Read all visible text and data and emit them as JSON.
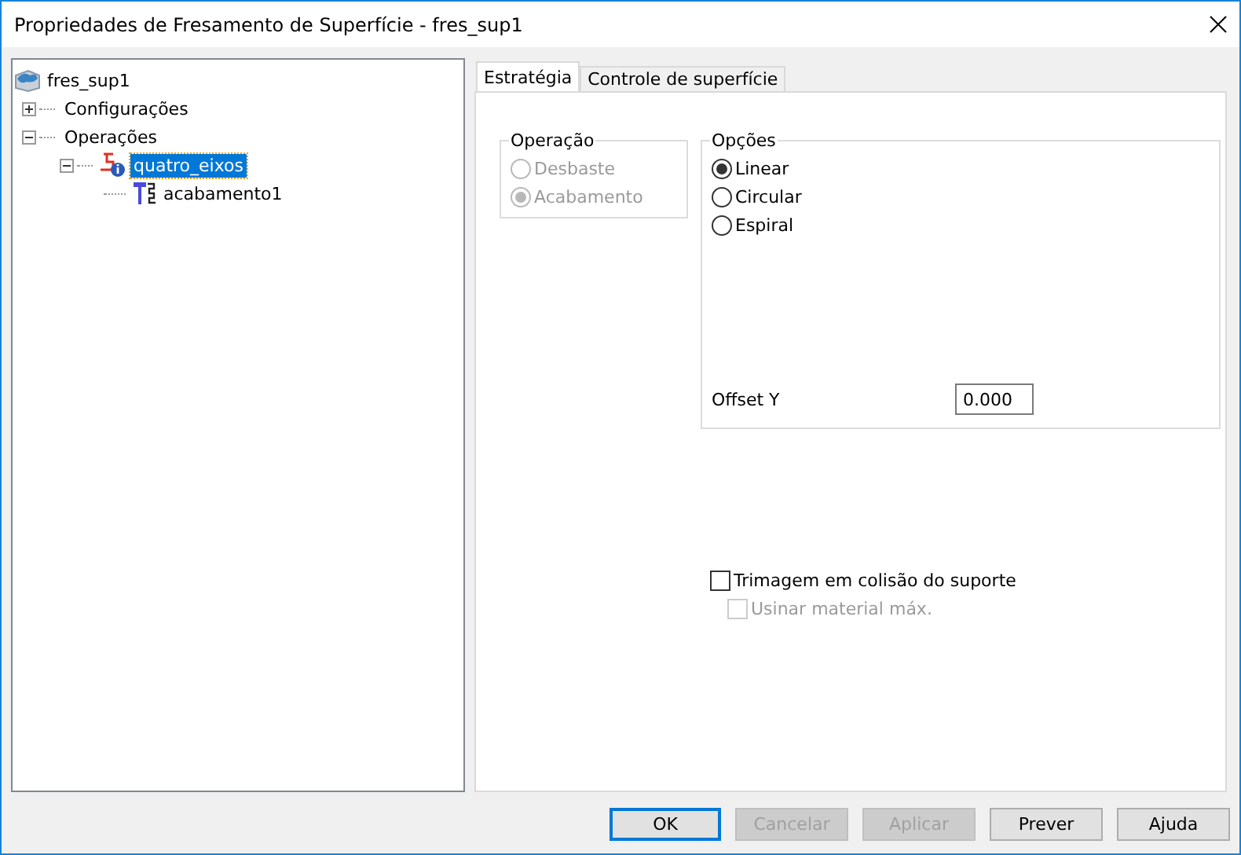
{
  "window": {
    "title": "Propriedades de Fresamento de Superfície - fres_sup1"
  },
  "tree": [
    {
      "label": "fres_sup1",
      "kind": "model",
      "selected": false,
      "children": [
        {
          "label": "Configurações",
          "expanded": false,
          "selected": false
        },
        {
          "label": "Operações",
          "expanded": true,
          "selected": false,
          "children": [
            {
              "label": "quatro_eixos",
              "kind": "operation",
              "expanded": true,
              "selected": true,
              "children": [
                {
                  "label": "acabamento1",
                  "kind": "toolpath",
                  "selected": false
                }
              ]
            }
          ]
        }
      ]
    }
  ],
  "tabs": [
    {
      "label": "Estratégia",
      "selected": true
    },
    {
      "label": "Controle de superfície",
      "selected": false
    }
  ],
  "operation_group": {
    "title": "Operação",
    "disabled": true,
    "options": [
      {
        "label": "Desbaste",
        "selected": false
      },
      {
        "label": "Acabamento",
        "selected": true
      }
    ]
  },
  "options_group": {
    "title": "Opções",
    "options": [
      {
        "label": "Linear",
        "selected": true
      },
      {
        "label": "Circular",
        "selected": false
      },
      {
        "label": "Espiral",
        "selected": false
      }
    ],
    "offset_y": {
      "label": "Offset Y",
      "value": "0.000"
    }
  },
  "checkboxes": [
    {
      "label": "Trimagem em colisão do suporte",
      "checked": false,
      "disabled": false,
      "children": [
        {
          "label": "Usinar material máx.",
          "checked": false,
          "disabled": true
        }
      ]
    }
  ],
  "buttons": [
    {
      "label": "OK",
      "disabled": false,
      "default": true
    },
    {
      "label": "Cancelar",
      "disabled": true,
      "default": false
    },
    {
      "label": "Aplicar",
      "disabled": true,
      "default": false
    },
    {
      "label": "Prever",
      "disabled": false,
      "default": false
    },
    {
      "label": "Ajuda",
      "disabled": false,
      "default": false
    }
  ]
}
